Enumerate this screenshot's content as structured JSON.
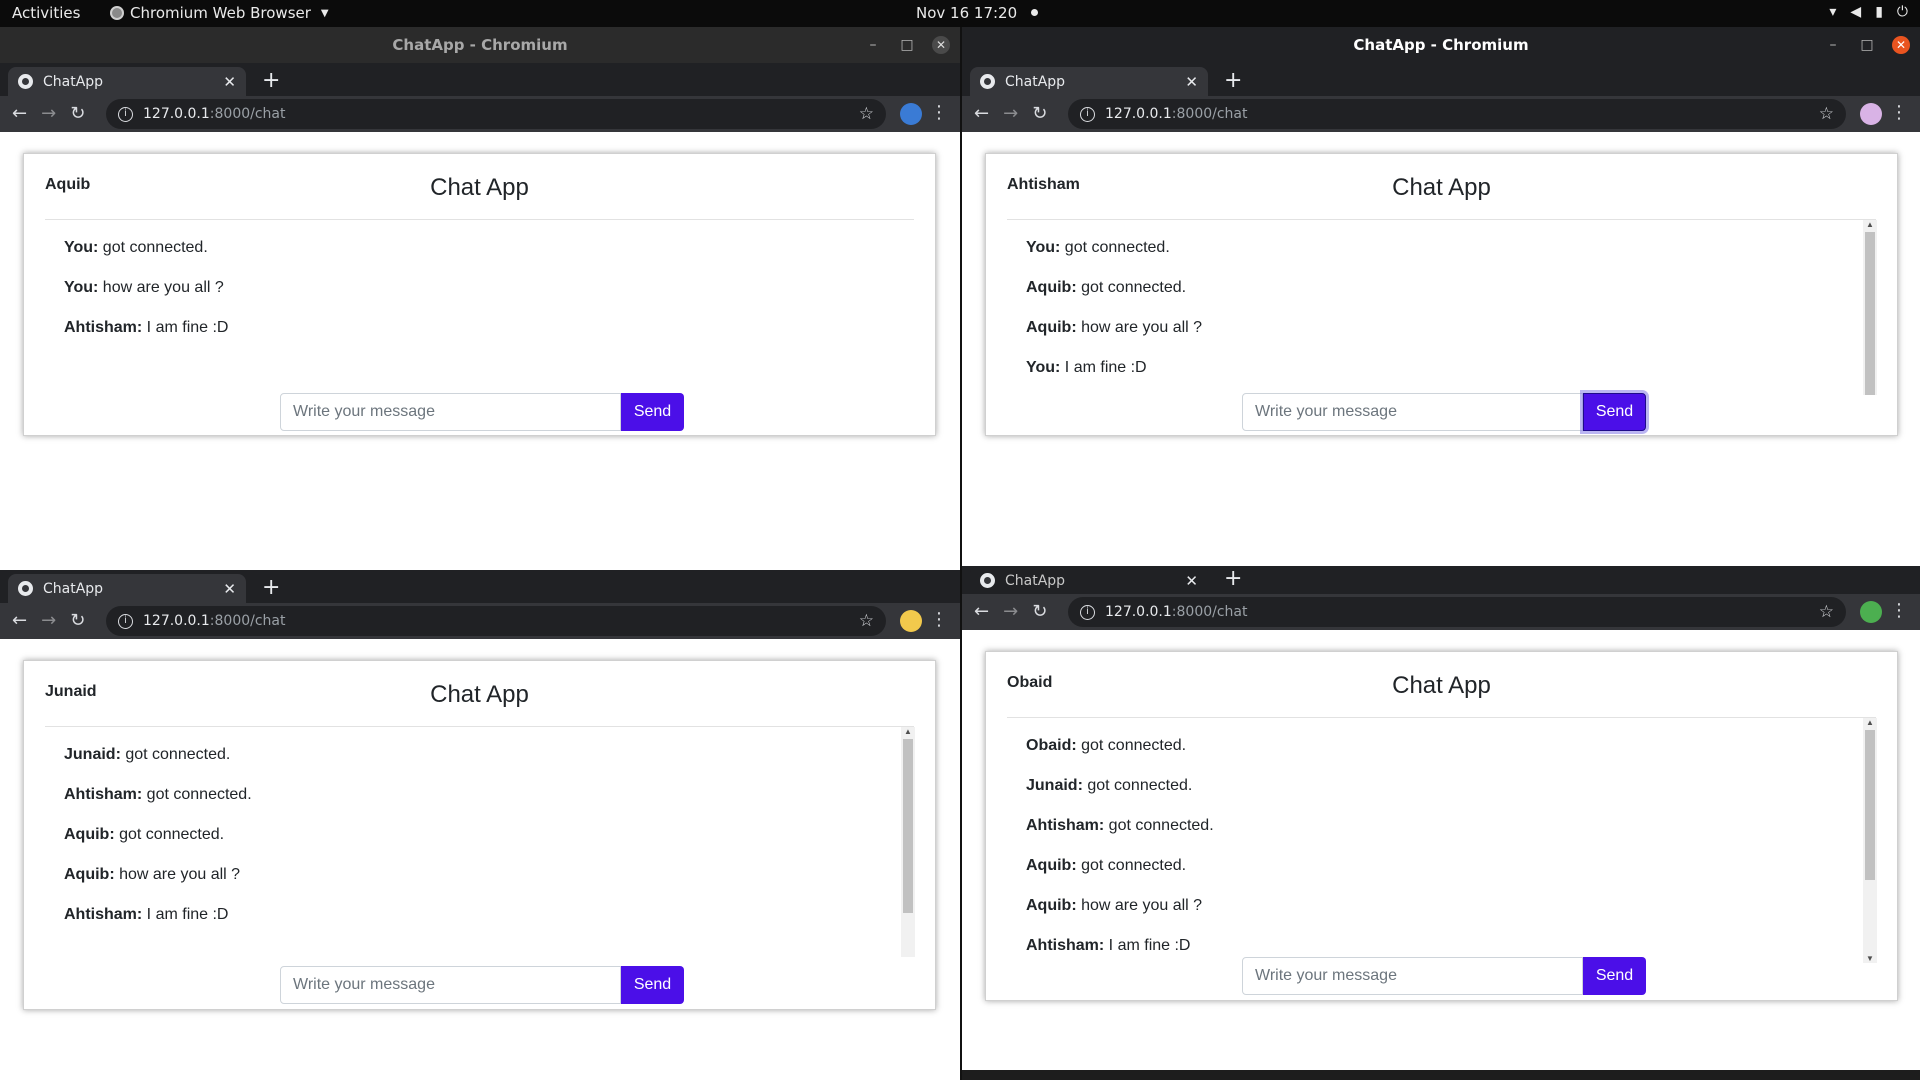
{
  "topbar": {
    "activities": "Activities",
    "app_name": "Chromium Web Browser",
    "clock": "Nov 16  17:20"
  },
  "windows": [
    {
      "title": "ChatApp - Chromium",
      "tab_label": "ChatApp",
      "url_host": "127.0.0.1",
      "url_path": ":8000/chat",
      "user": "Aquib",
      "app_title": "Chat App",
      "placeholder": "Write your message",
      "send_label": "Send",
      "messages": [
        {
          "sender": "You:",
          "text": " got connected."
        },
        {
          "sender": "You:",
          "text": " how are you all ?"
        },
        {
          "sender": "Ahtisham:",
          "text": " I am fine :D"
        }
      ]
    },
    {
      "title": "ChatApp - Chromium",
      "tab_label": "ChatApp",
      "url_host": "127.0.0.1",
      "url_path": ":8000/chat",
      "user": "Ahtisham",
      "app_title": "Chat App",
      "placeholder": "Write your message",
      "send_label": "Send",
      "messages": [
        {
          "sender": "You:",
          "text": " got connected."
        },
        {
          "sender": "Aquib:",
          "text": " got connected."
        },
        {
          "sender": "Aquib:",
          "text": " how are you all ?"
        },
        {
          "sender": "You:",
          "text": " I am fine :D"
        }
      ]
    },
    {
      "tab_label": "ChatApp",
      "url_host": "127.0.0.1",
      "url_path": ":8000/chat",
      "user": "Junaid",
      "app_title": "Chat App",
      "placeholder": "Write your message",
      "send_label": "Send",
      "messages": [
        {
          "sender": "Junaid:",
          "text": " got connected."
        },
        {
          "sender": "Ahtisham:",
          "text": " got connected."
        },
        {
          "sender": "Aquib:",
          "text": " got connected."
        },
        {
          "sender": "Aquib:",
          "text": " how are you all ?"
        },
        {
          "sender": "Ahtisham:",
          "text": " I am fine :D"
        }
      ]
    },
    {
      "tab_label": "ChatApp",
      "url_host": "127.0.0.1",
      "url_path": ":8000/chat",
      "user": "Obaid",
      "app_title": "Chat App",
      "placeholder": "Write your message",
      "send_label": "Send",
      "messages": [
        {
          "sender": "Obaid:",
          "text": " got connected."
        },
        {
          "sender": "Junaid:",
          "text": " got connected."
        },
        {
          "sender": "Ahtisham:",
          "text": " got connected."
        },
        {
          "sender": "Aquib:",
          "text": " got connected."
        },
        {
          "sender": "Aquib:",
          "text": " how are you all ?"
        },
        {
          "sender": "Ahtisham:",
          "text": " I am fine :D"
        }
      ]
    }
  ],
  "colors": {
    "send_button": "#4b0fe8",
    "close_active": "#e95420",
    "profile_1": "#3a7bd5",
    "profile_2": "#d9b3e6",
    "profile_3": "#f2c94c",
    "profile_4": "#4caf50"
  }
}
